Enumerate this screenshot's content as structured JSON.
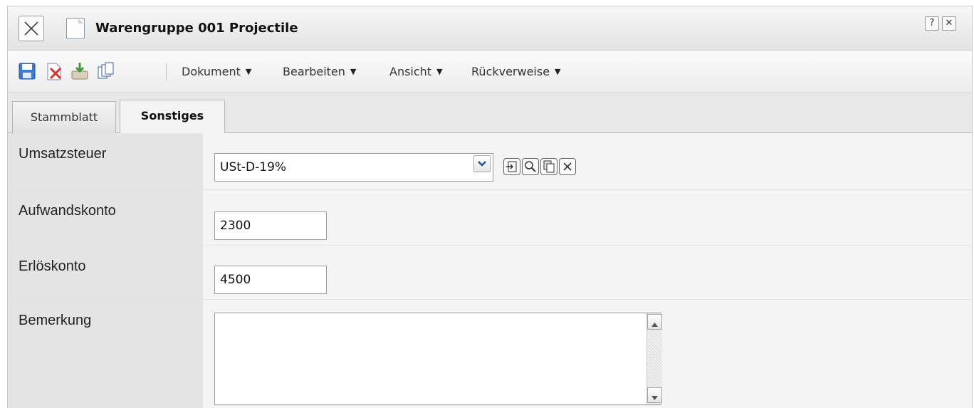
{
  "window": {
    "title": "Warengruppe 001 Projectile",
    "help_label": "?",
    "close_label": "✕"
  },
  "toolbar": {
    "icons": [
      "save-icon",
      "delete-document-icon",
      "export-icon",
      "copy-icon"
    ],
    "menus": [
      {
        "label": "Dokument"
      },
      {
        "label": "Bearbeiten"
      },
      {
        "label": "Ansicht"
      },
      {
        "label": "Rückverweise"
      }
    ]
  },
  "tabs": [
    {
      "label": "Stammblatt",
      "active": false
    },
    {
      "label": "Sonstiges",
      "active": true
    }
  ],
  "form": {
    "umsatzsteuer": {
      "label": "Umsatzsteuer",
      "value": "USt-D-19%"
    },
    "aufwandskonto": {
      "label": "Aufwandskonto",
      "value": "2300"
    },
    "erloeskonto": {
      "label": "Erlöskonto",
      "value": "4500"
    },
    "bemerkung": {
      "label": "Bemerkung",
      "value": ""
    },
    "field_buttons": [
      "open-link-icon",
      "search-icon",
      "copy-icon",
      "clear-icon"
    ]
  },
  "colors": {
    "accent_blue": "#1f5fb8",
    "label_bg": "#e4e4e4",
    "content_bg": "#f4f4f4"
  }
}
